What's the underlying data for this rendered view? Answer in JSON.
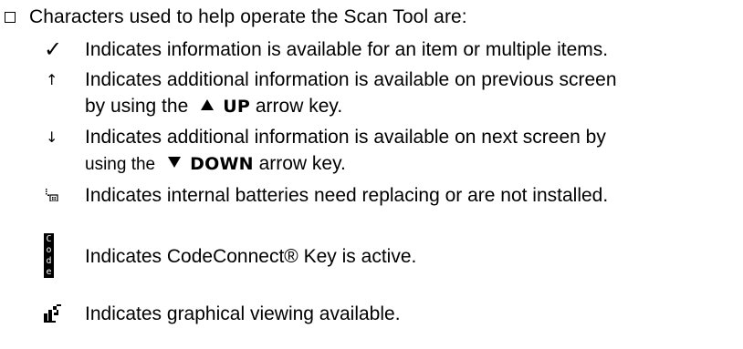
{
  "heading": "Characters used to help operate the Scan Tool are:",
  "items": [
    {
      "icon": "checkmark-icon",
      "symbol": "✓",
      "lines": [
        "Indicates information is available for an item or multiple items."
      ]
    },
    {
      "icon": "up-arrow-icon",
      "symbol": "↑",
      "line1": "Indicates additional information is available on previous screen",
      "line2_pre": "by using the",
      "key": "UP",
      "line2_post": "arrow key."
    },
    {
      "icon": "down-arrow-icon",
      "symbol": "↓",
      "line1": "Indicates additional information is available on next screen by",
      "line2_pre": "using the",
      "key": "DOWN",
      "line2_post": "arrow key."
    },
    {
      "icon": "battery-icon",
      "lines": [
        "Indicates internal batteries need replacing or are not installed."
      ]
    },
    {
      "icon": "code-icon",
      "code_letters": [
        "C",
        "o",
        "d",
        "e"
      ],
      "lines": [
        "Indicates CodeConnect® Key is active."
      ]
    },
    {
      "icon": "graph-icon",
      "lines": [
        "Indicates graphical viewing available."
      ]
    }
  ]
}
